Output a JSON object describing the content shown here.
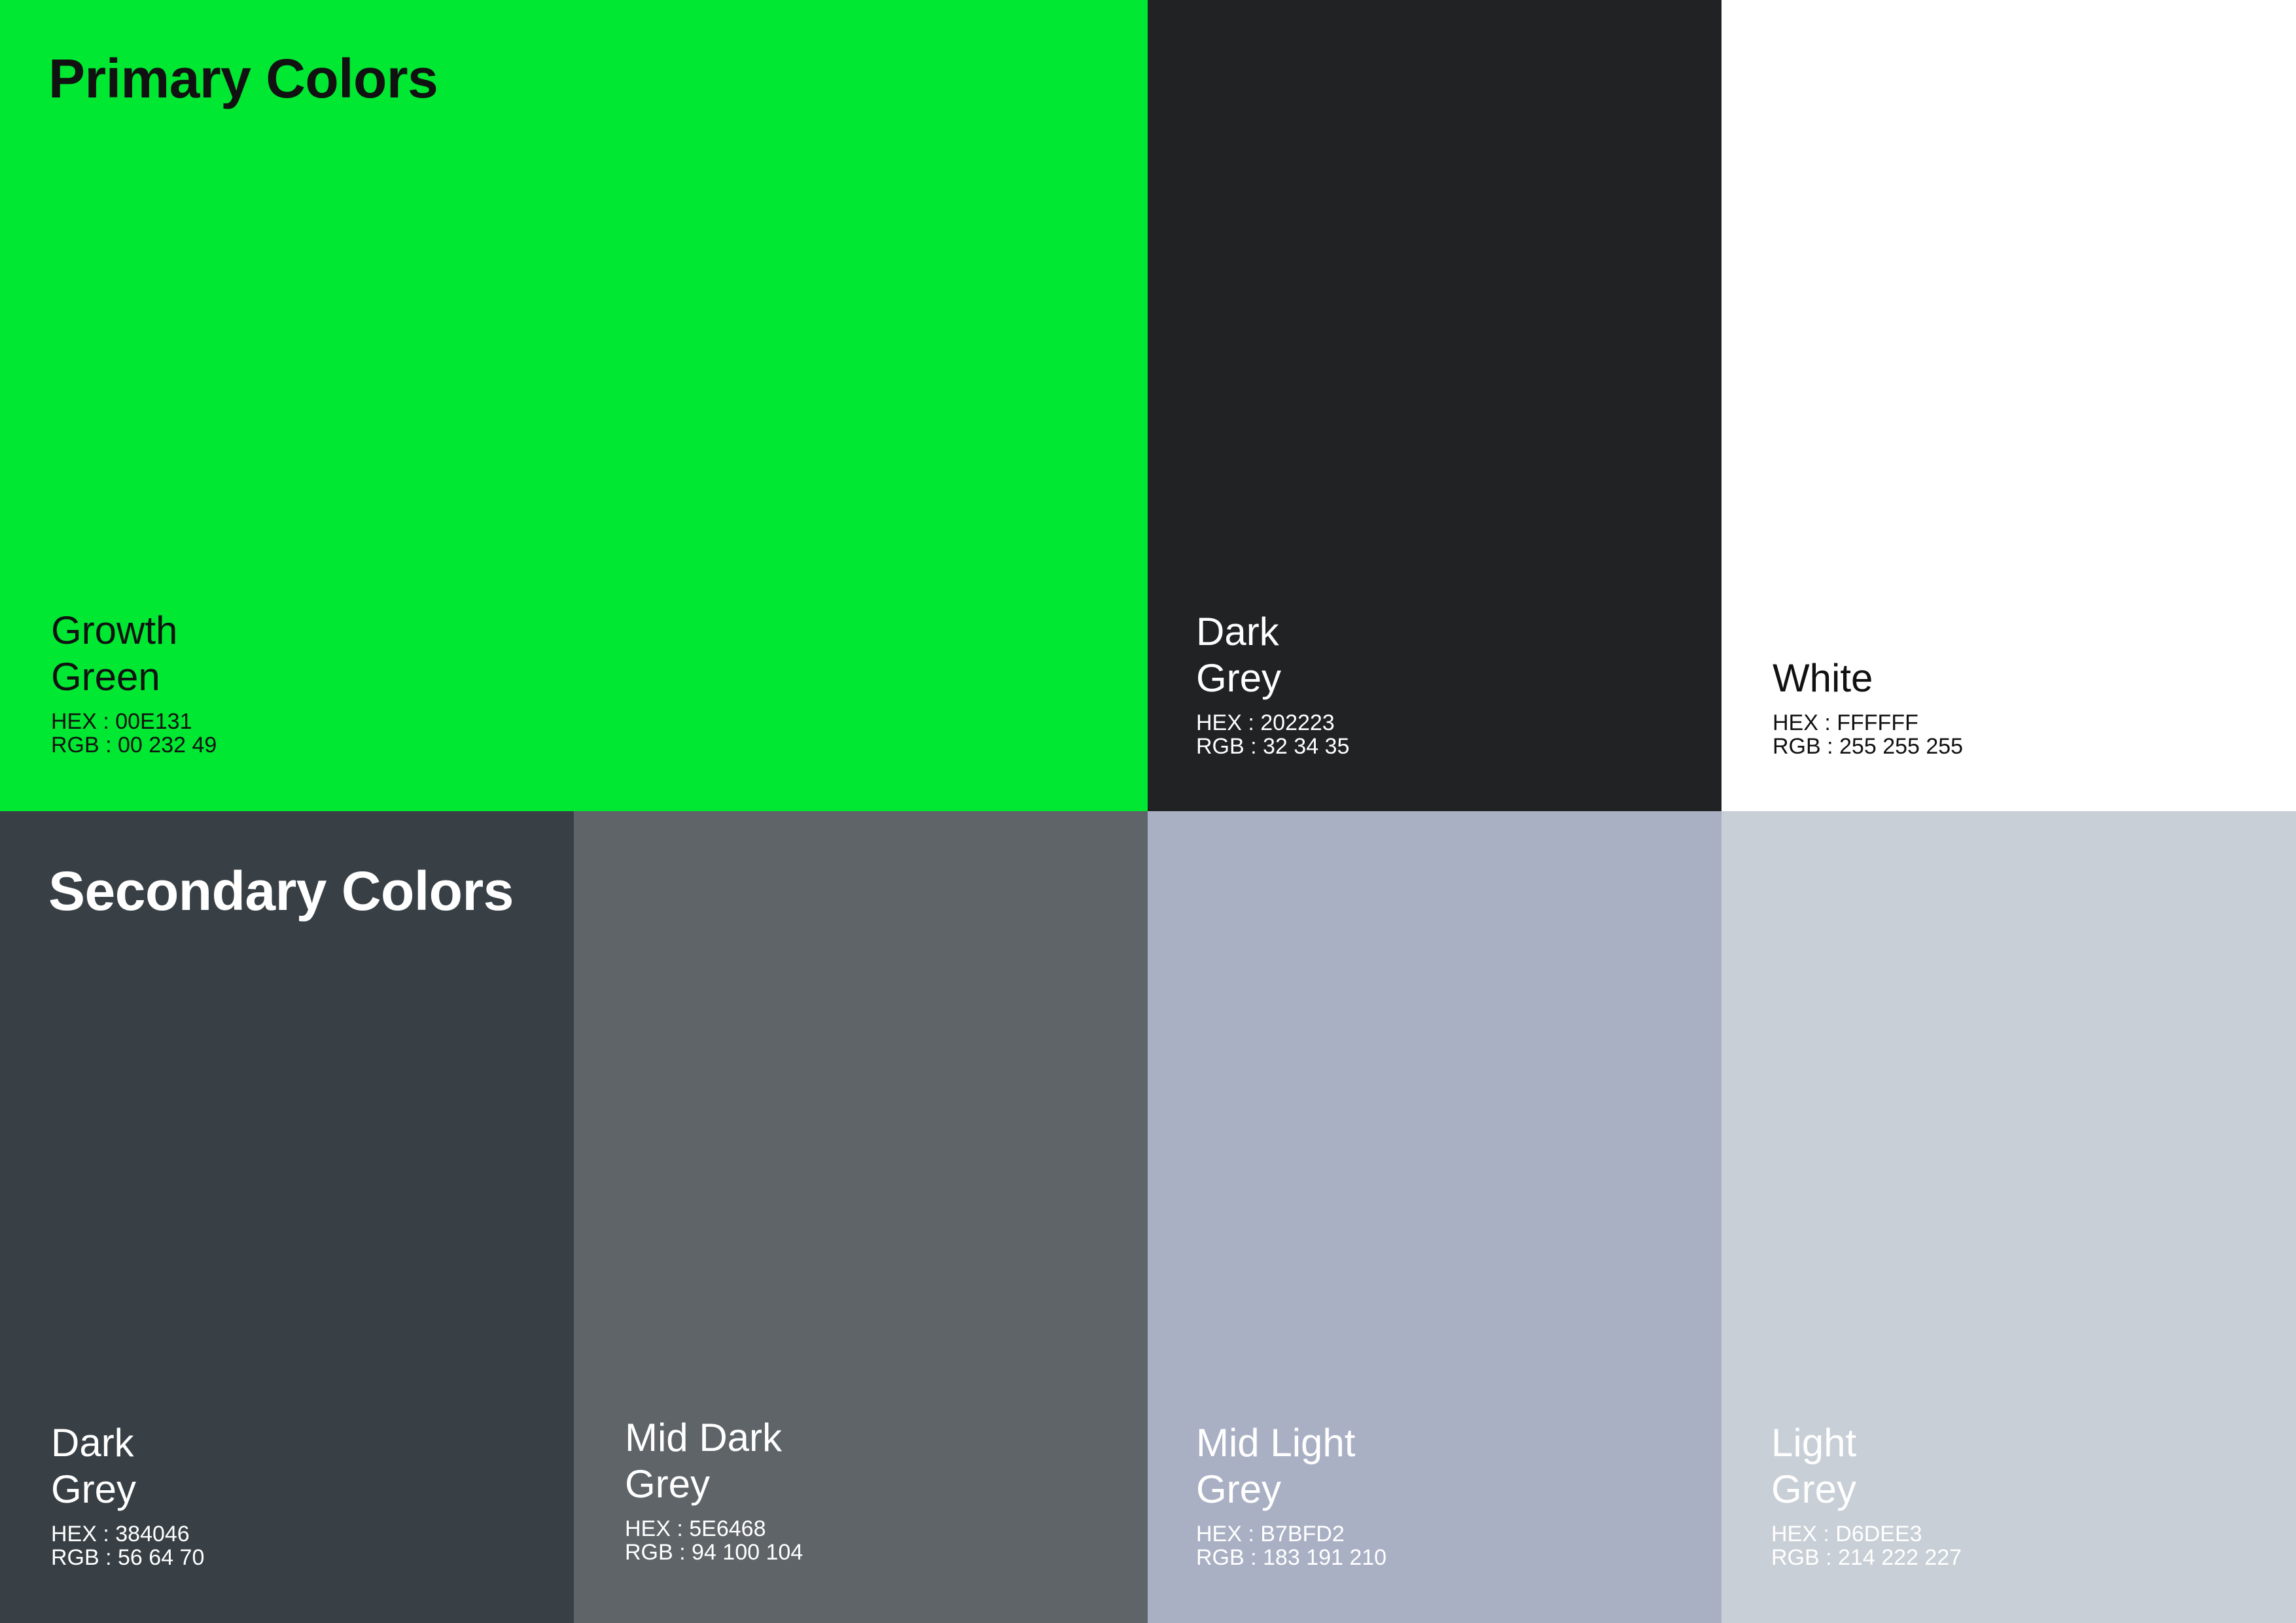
{
  "primary": {
    "title": "Primary Colors",
    "swatches": [
      {
        "name_line1": "Growth",
        "name_line2": "Green",
        "hex": "HEX : 00E131",
        "rgb": "RGB : 00 232 49",
        "color": "#00E831",
        "text_color": "#111111"
      },
      {
        "name_line1": "Dark",
        "name_line2": "Grey",
        "hex": "HEX : 202223",
        "rgb": "RGB : 32 34 35",
        "color": "#202223",
        "text_color": "#FFFFFF"
      },
      {
        "name_line1": "",
        "name_line2": "White",
        "hex": "HEX : FFFFFF",
        "rgb": "RGB : 255 255 255",
        "color": "#FFFFFF",
        "text_color": "#111111"
      }
    ]
  },
  "secondary": {
    "title": "Secondary Colors",
    "swatches": [
      {
        "name_line1": "Dark",
        "name_line2": "Grey",
        "hex": "HEX : 384046",
        "rgb": "RGB : 56 64 70",
        "color": "#384046",
        "text_color": "#FFFFFF"
      },
      {
        "name_line1": "Mid Dark",
        "name_line2": "Grey",
        "hex": "HEX : 5E6468",
        "rgb": "RGB : 94 100 104",
        "color": "#5E6468",
        "text_color": "#FFFFFF"
      },
      {
        "name_line1": "Mid Light",
        "name_line2": "Grey",
        "hex": "HEX : B7BFD2",
        "rgb": "RGB : 183 191 210",
        "color": "#AAB0C4",
        "text_color": "#FFFFFF"
      },
      {
        "name_line1": "Light",
        "name_line2": "Grey",
        "hex": "HEX : D6DEE3",
        "rgb": "RGB : 214 222 227",
        "color": "#C8CFD6",
        "text_color": "#FFFFFF"
      }
    ]
  }
}
